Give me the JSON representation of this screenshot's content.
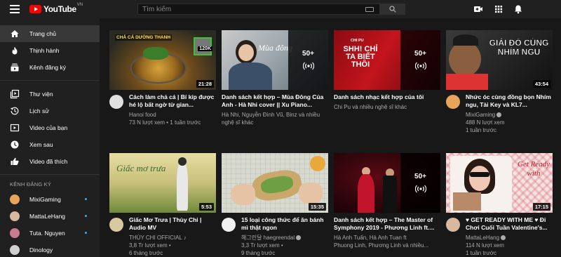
{
  "header": {
    "logo_text": "YouTube",
    "country_code": "VN",
    "search_placeholder": "Tìm kiếm"
  },
  "sidebar": {
    "primary": [
      {
        "label": "Trang chủ",
        "icon": "home-icon",
        "active": true
      },
      {
        "label": "Thịnh hành",
        "icon": "trending-icon"
      },
      {
        "label": "Kênh đăng ký",
        "icon": "subscriptions-icon"
      }
    ],
    "library": [
      {
        "label": "Thư viện",
        "icon": "library-icon"
      },
      {
        "label": "Lịch sử",
        "icon": "history-icon"
      },
      {
        "label": "Video của bạn",
        "icon": "your-videos-icon"
      },
      {
        "label": "Xem sau",
        "icon": "watch-later-icon"
      },
      {
        "label": "Video đã thích",
        "icon": "liked-icon"
      }
    ],
    "subscriptions_heading": "KÊNH ĐĂNG KÝ",
    "subscriptions": [
      {
        "label": "MixiGaming",
        "color": "#e8a55a",
        "new": true
      },
      {
        "label": "MattaLeHang",
        "color": "#d9b8a0",
        "new": true
      },
      {
        "label": "Tuta. Nguyen",
        "color": "#c97b92",
        "new": true
      },
      {
        "label": "Dinology",
        "color": "#d0d0d0",
        "new": false
      }
    ]
  },
  "videos": [
    {
      "title": "Cách làm chả cá | Bí kíp được hé lộ bất ngờ từ gian...",
      "channel": "Hanoi food",
      "stats": "73 N lượt xem • 1 tuần trước",
      "duration": "21:28",
      "thumb_label": "CHẢ CÁ DƯỜNG THANH",
      "avatar_color": "#e0e0e0"
    },
    {
      "title": "Danh sách kết hợp – Mùa Đông Của Anh - Hà Nhi cover || Xu Piano...",
      "channel": "Hà Nhi, Nguyễn Đình Vũ, Binz và nhiều nghệ sĩ khác",
      "stats": "",
      "mix_count": "50+",
      "thumb_label": "Mùa đông"
    },
    {
      "title": "Danh sách nhạc kết hợp của tôi",
      "channel": "Chi Pu và nhiều nghệ sĩ khác",
      "stats": "",
      "mix_count": "50+",
      "thumb_label": "SHH! CHỈ TA BIẾT THÔI",
      "thumb_small": "CHI PU"
    },
    {
      "title": "Nhức óc cùng đồng bọn Nhím ngu, Tài Key và KL7...",
      "channel": "MixiGaming",
      "stats": "488 N lượt xem",
      "stats2": "1 tuần trước",
      "verified": true,
      "duration": "43:54",
      "thumb_label": "GIẢI ĐỐ CÙNG NHÍM NGU",
      "avatar_color": "#e8a55a"
    },
    {
      "title": "Giấc Mơ Trưa | Thùy Chi | Audio MV",
      "channel": "THÙY CHI OFFICIAL ♪",
      "stats": "3,8 Tr lượt xem •",
      "stats2": "6 tháng trước",
      "duration": "5:53",
      "thumb_label": "Giấc mơ trưa",
      "avatar_color": "#d9c9a0"
    },
    {
      "title": "15 loại công thức để ăn bánh mì thật ngon",
      "channel": "해그린달 haegreendal",
      "stats": "3,3 Tr lượt xem •",
      "stats2": "9 tháng trước",
      "verified": true,
      "duration": "15:35",
      "avatar_color": "#f0f0f0"
    },
    {
      "title": "Danh sách kết hợp – The Master of Symphony 2019 - Phương Linh ft....",
      "channel": "Hà Anh Tuấn, Hà Anh Tuan ft",
      "stats": "Phuong Linh, Phương Linh và nhiều...",
      "mix_count": "50+"
    },
    {
      "title": "♥ GET READY WITH ME ♥ Đi Chơi Cuối Tuần Valentine's...",
      "channel": "MattaLeHang",
      "stats": "114 N lượt xem",
      "stats2": "1 tuần trước",
      "verified": true,
      "duration": "17:15",
      "thumb_label": "Get Ready with",
      "avatar_color": "#d9b8a0"
    }
  ]
}
